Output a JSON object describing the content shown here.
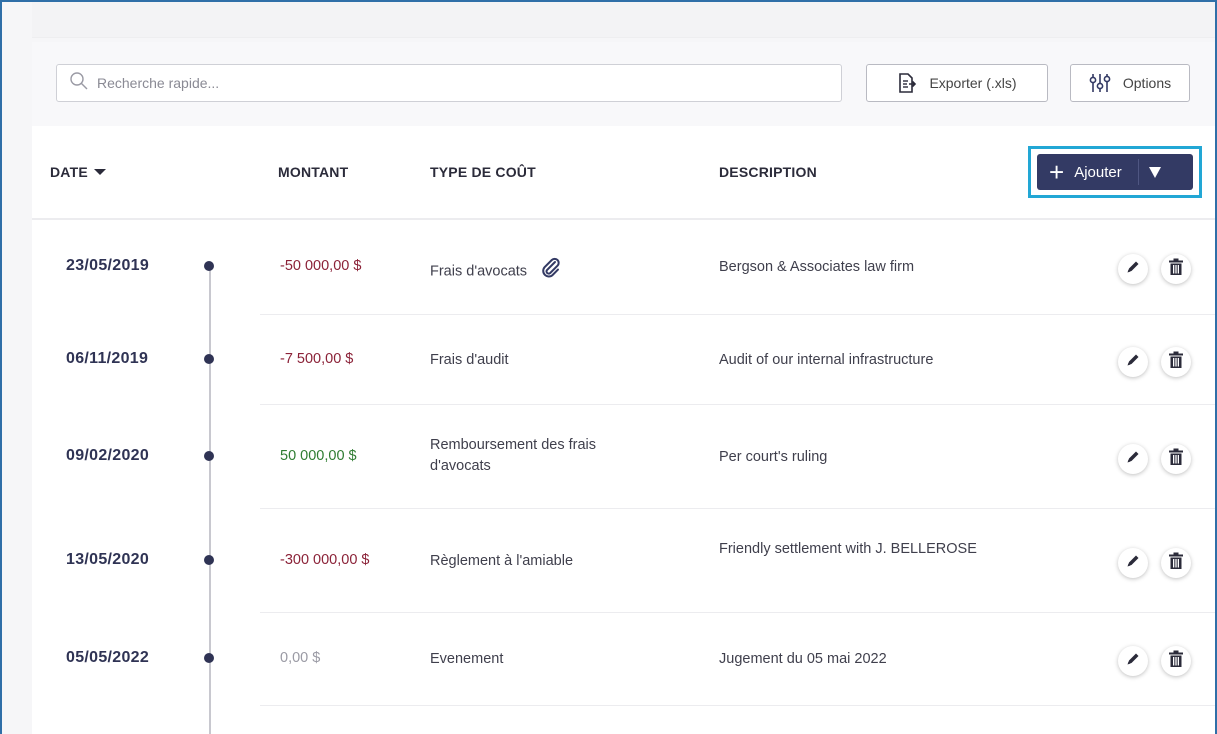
{
  "toolbar": {
    "search_placeholder": "Recherche rapide...",
    "export_label": "Exporter (.xls)",
    "options_label": "Options",
    "search_icon": "search-icon",
    "export_icon": "file-export-icon",
    "options_icon": "sliders-icon"
  },
  "table": {
    "columns": {
      "date": "DATE",
      "montant": "MONTANT",
      "type": "TYPE DE COÛT",
      "description": "DESCRIPTION"
    },
    "add_label": "Ajouter",
    "rows": [
      {
        "date": "23/05/2019",
        "amount": "-50 000,00 $",
        "amount_status": "negative",
        "type": "Frais d'avocats",
        "has_attachment": true,
        "description": "Bergson & Associates law firm"
      },
      {
        "date": "06/11/2019",
        "amount": "-7 500,00 $",
        "amount_status": "negative",
        "type": "Frais d'audit",
        "has_attachment": false,
        "description": "Audit of our internal infrastructure"
      },
      {
        "date": "09/02/2020",
        "amount": "50 000,00 $",
        "amount_status": "positive",
        "type": "Remboursement des frais d'avocats",
        "has_attachment": false,
        "description": "Per court's ruling"
      },
      {
        "date": "13/05/2020",
        "amount": "-300 000,00 $",
        "amount_status": "negative",
        "type": "Règlement à l'amiable",
        "has_attachment": false,
        "description": "Friendly settlement with J. BELLEROSE"
      },
      {
        "date": "05/05/2022",
        "amount": "0,00 $",
        "amount_status": "zero",
        "type": "Evenement",
        "has_attachment": false,
        "description": "Jugement du 05 mai 2022"
      }
    ]
  },
  "colors": {
    "primary": "#333a64",
    "highlight": "#22a7d5",
    "negative": "#8b2238",
    "positive": "#2f7d32",
    "zero": "#9a9aa4"
  }
}
